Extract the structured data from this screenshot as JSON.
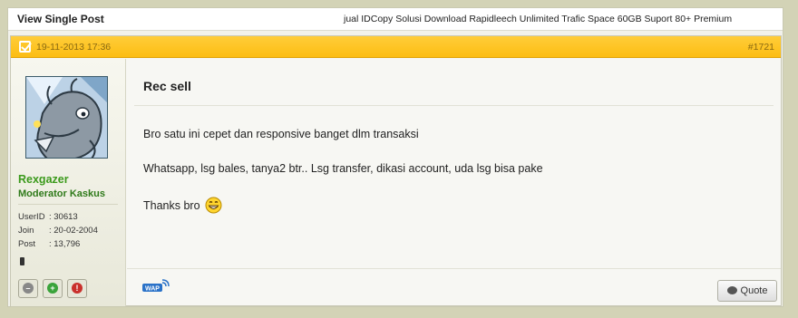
{
  "topbar": {
    "title": "View Single Post",
    "thread_title": "jual IDCopy Solusi Download Rapidleech Unlimited Trafic Space 60GB Suport 80+ Premium"
  },
  "post": {
    "date": "19-11-2013 17:36",
    "number": "#1721",
    "title": "Rec sell",
    "lines": [
      "Bro satu ini cepet dan responsive banget dlm transaksi",
      "Whatsapp, lsg bales, tanya2 btr.. Lsg transfer, dikasi account, uda lsg bisa pake",
      "Thanks bro"
    ],
    "quote_label": "Quote"
  },
  "user": {
    "name": "Rexgazer",
    "title": "Moderator Kaskus",
    "stats": [
      {
        "label": "UserID",
        "value": ": 30613"
      },
      {
        "label": "Join",
        "value": ": 20-02-2004"
      },
      {
        "label": "Post",
        "value": ": 13,796"
      }
    ]
  },
  "colors": {
    "header_bg": "#fcbd12",
    "username": "#3b9a1c",
    "background": "#d3d3b6"
  },
  "icons": {
    "check": "checkbox-icon",
    "smiley": "grin-smiley-icon",
    "wap": "wap-icon",
    "quote": "speech-bubble-icon"
  }
}
